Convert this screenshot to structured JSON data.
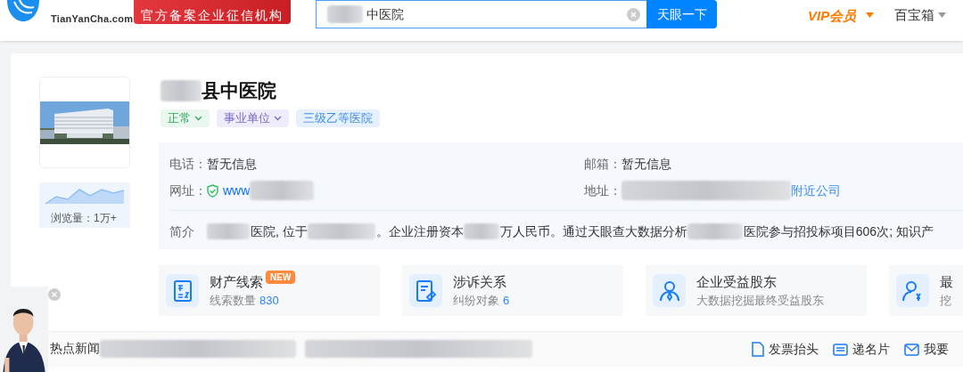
{
  "header": {
    "logo_domain": "TianYanCha.com",
    "banner": "官方备案企业征信机构",
    "search": {
      "value": "中医院",
      "button": "天眼一下"
    },
    "vip": "VIP会员",
    "toolbox": "百宝箱"
  },
  "company": {
    "name": "县中医院",
    "tags": [
      {
        "label": "正常",
        "color": "#2fa55a",
        "dropdown": true
      },
      {
        "label": "事业单位",
        "color": "#7b6bc8",
        "dropdown": true
      },
      {
        "label": "三级乙等医院",
        "color": "#3f8ee8",
        "dropdown": false
      }
    ],
    "views": "浏览量：1万+",
    "info": [
      {
        "label": "电话：",
        "value": "暂无信息",
        "kind": "text"
      },
      {
        "label": "邮箱：",
        "value": "暂无信息",
        "kind": "text"
      },
      {
        "label": "网址：",
        "value": "www",
        "kind": "website"
      },
      {
        "label": "地址：",
        "value": "附近公司",
        "kind": "address"
      }
    ],
    "intro_label": "简介",
    "intro": [
      "医院, 位于",
      "。企业注册资本",
      "万人民币。通过天眼查大数据分析",
      "医院参与招投标项目606次; 知识产"
    ]
  },
  "cards": [
    {
      "title": "财产线索",
      "subtitle": "线索数量",
      "count": "830",
      "badge": "NEW"
    },
    {
      "title": "涉诉关系",
      "subtitle": "纠纷对象",
      "count": "6"
    },
    {
      "title": "企业受益股东",
      "subtitle": "大数据挖掘最终受益股东"
    },
    {
      "title": "最",
      "subtitle": "挖"
    }
  ],
  "news": {
    "label": "热点新闻",
    "actions": [
      {
        "label": "发票抬头"
      },
      {
        "label": "递名片"
      },
      {
        "label": "我要"
      }
    ]
  }
}
